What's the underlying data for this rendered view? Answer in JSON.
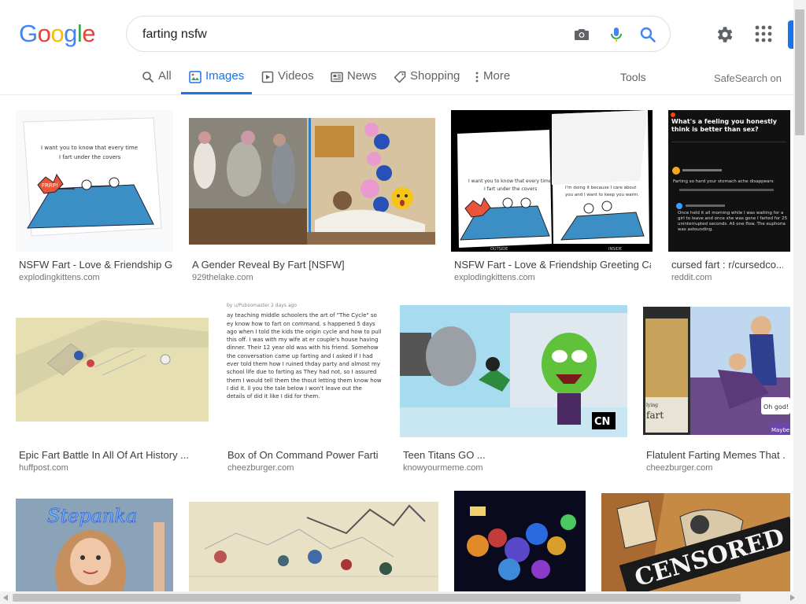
{
  "logo": {
    "letters": [
      "G",
      "o",
      "o",
      "g",
      "l",
      "e"
    ],
    "colors": [
      "#4285F4",
      "#EA4335",
      "#FBBC05",
      "#4285F4",
      "#34A853",
      "#EA4335"
    ]
  },
  "search": {
    "query": "farting nsfw"
  },
  "icons": {
    "camera": "camera-icon",
    "mic": "mic-icon",
    "search": "search-icon",
    "settings": "gear-icon",
    "apps": "apps-grid-icon"
  },
  "tabs": [
    {
      "label": "All",
      "icon": "search-icon"
    },
    {
      "label": "Images",
      "icon": "image-icon"
    },
    {
      "label": "Videos",
      "icon": "video-icon"
    },
    {
      "label": "News",
      "icon": "news-icon"
    },
    {
      "label": "Shopping",
      "icon": "tag-icon"
    },
    {
      "label": "More",
      "icon": "kebab-icon"
    }
  ],
  "tools_label": "Tools",
  "safesearch_label": "SafeSearch on",
  "results": [
    {
      "title": "NSFW Fart - Love & Friendship Gr...",
      "source": "explodingkittens.com"
    },
    {
      "title": "A Gender Reveal By Fart [NSFW]",
      "source": "929thelake.com"
    },
    {
      "title": "NSFW Fart - Love & Friendship Greeting Card",
      "source": "explodingkittens.com"
    },
    {
      "title": "cursed fart : r/cursedco...",
      "source": "reddit.com"
    },
    {
      "title": "Epic Fart Battle In All Of Art History ...",
      "source": "huffpost.com"
    },
    {
      "title": "Box of On Command Power Farti...",
      "source": "cheezburger.com"
    },
    {
      "title": "Teen Titans GO ...",
      "source": "knowyourmeme.com"
    },
    {
      "title": "Flatulent Farting Memes That ...",
      "source": "cheezburger.com"
    }
  ],
  "image_text": {
    "card_line1": "I want you to know that every time",
    "card_line2": "I fart under the covers",
    "card_frrp": "FRRP!",
    "card_inside1": "I'm doing it because I care about",
    "card_inside2": "you and I want to keep you warm.",
    "card_outside": "OUTSIDE",
    "card_inside": "INSIDE",
    "reddit_question": "What's a feeling you honestly think is better than sex?",
    "reddit_comment1": "Farting so hard your stomach ache disappears",
    "reddit_comment2": "Once held it all morning while I was waiting for a girl to leave and once she was gone I farted for 25 uninterrupted seconds. All one flow. The euphoria was astounding.",
    "story_header": "by u/Pubsomaster 2 days ago",
    "story_text": "ay teaching middle schoolers the art of \"The Cycle\" so ey know how to fart on command. s happened 5 days ago when I told the kids the origin cycle and how to pull this off. I was with my wife at er couple's house having dinner. Their 12 year old was with his friend. Somehow the conversation came up farting and I asked if I had ever told them how I ruined thday party and almost my school life due to farting as They had not, so I assured them I would tell them the thout letting them know how I did it. ll you the tale below I won't leave out the details of did it like I did for them.",
    "cn_logo": "CN",
    "mtg_text": "fart",
    "mtg_flying": "lying",
    "ohgod": "Oh god!",
    "maybe": "Maybe",
    "neon": "Stepanka",
    "censored": "CENSORED"
  }
}
